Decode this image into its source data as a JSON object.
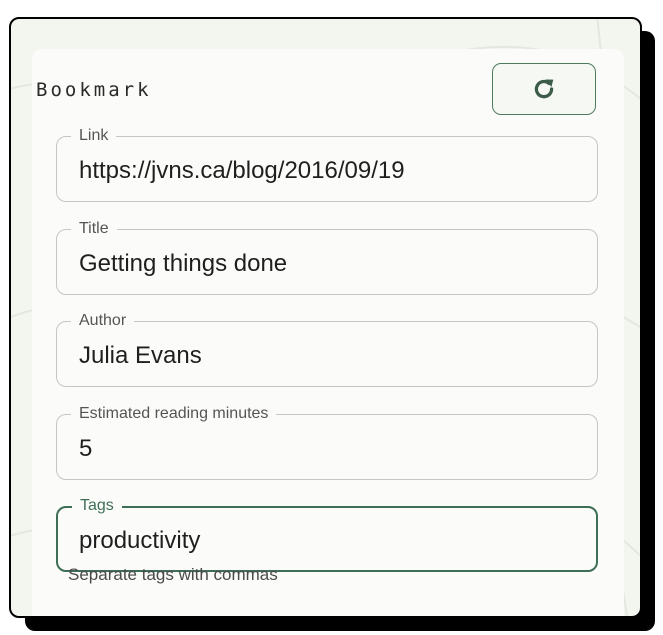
{
  "card": {
    "title": "Bookmark",
    "refresh_icon": "refresh-icon"
  },
  "fields": {
    "link": {
      "label": "Link",
      "value": "https://jvns.ca/blog/2016/09/19"
    },
    "title": {
      "label": "Title",
      "value": "Getting things done"
    },
    "author": {
      "label": "Author",
      "value": "Julia Evans"
    },
    "minutes": {
      "label": "Estimated reading minutes",
      "value": "5"
    },
    "tags": {
      "label": "Tags",
      "value": "productivity",
      "helper": "Separate tags with commas"
    }
  },
  "colors": {
    "accent": "#3f6e56",
    "background": "#f3f5ef",
    "card": "#fbfcf9"
  }
}
